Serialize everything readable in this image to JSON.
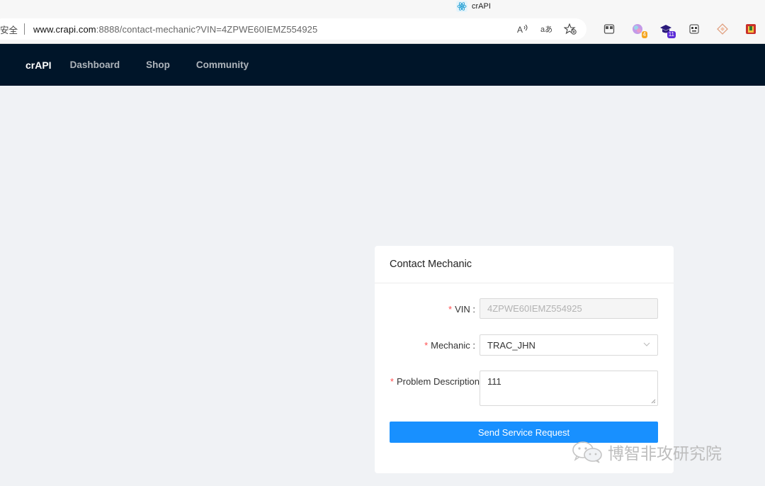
{
  "browser": {
    "tab_title": "crAPI",
    "security_label": "安全",
    "url_host": "www.crapi.com",
    "url_rest": ":8888/contact-mechanic?VIN=4ZPWE60IEMZ554925",
    "addr_icons": [
      "read-aloud-icon",
      "translate-icon",
      "favorite-add-icon"
    ],
    "extensions": [
      {
        "name": "extension-sidebar-icon",
        "badge": ""
      },
      {
        "name": "extension-color-icon",
        "badge": "4",
        "badge_color": "#f5a623"
      },
      {
        "name": "extension-cap-icon",
        "badge": "11",
        "badge_color": "#5b2bd6"
      },
      {
        "name": "extension-panda-icon",
        "badge": ""
      },
      {
        "name": "extension-diamond-icon",
        "badge": ""
      },
      {
        "name": "extension-bracket-icon",
        "badge": ""
      }
    ]
  },
  "nav": {
    "brand": "crAPI",
    "items": [
      "Dashboard",
      "Shop",
      "Community"
    ]
  },
  "card": {
    "title": "Contact Mechanic",
    "vin_label": "VIN",
    "vin_value": "4ZPWE60IEMZ554925",
    "mechanic_label": "Mechanic",
    "mechanic_value": "TRAC_JHN",
    "problem_label": "Problem Description",
    "problem_value": "111",
    "send_button": "Send Service Request"
  },
  "watermark": {
    "text": "博智非攻研究院"
  },
  "colors": {
    "nav_bg": "#001529",
    "primary": "#1890ff",
    "required": "#ff4d4f",
    "page_bg": "#f0f2f5"
  }
}
